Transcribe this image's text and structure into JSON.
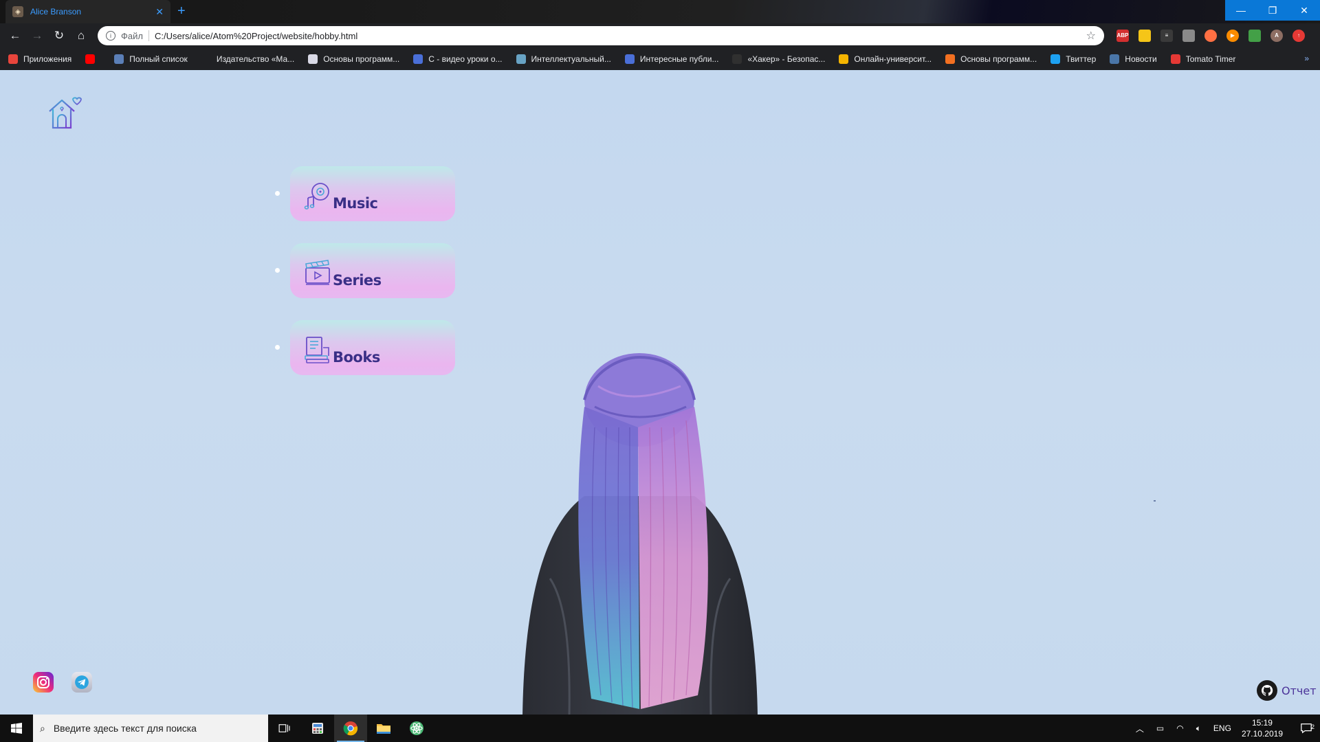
{
  "browser": {
    "tab_title": "Alice Branson",
    "tab_close": "✕",
    "new_tab": "+",
    "scheme_label": "Файл",
    "url": "C:/Users/alice/Atom%20Project/website/hobby.html",
    "window_controls": {
      "minimize": "—",
      "restore": "❐",
      "close": "✕"
    },
    "bookmarks": [
      {
        "label": "Приложения",
        "color": "#e8453c"
      },
      {
        "label": "",
        "color": "#ff0000"
      },
      {
        "label": "Полный список",
        "color": "#5b7fb7"
      },
      {
        "label": "Издательство «Ма...",
        "color": "#202124"
      },
      {
        "label": "Основы программ...",
        "color": "#d9d9e6"
      },
      {
        "label": "C - видео уроки о...",
        "color": "#4a6fd8"
      },
      {
        "label": "Интеллектуальный...",
        "color": "#68a3c4"
      },
      {
        "label": "Интересные публи...",
        "color": "#4a6fd8"
      },
      {
        "label": "«Хакер» - Безопас...",
        "color": "#303030"
      },
      {
        "label": "Онлайн-университ...",
        "color": "#f4b400"
      },
      {
        "label": "Основы программ...",
        "color": "#f37021"
      },
      {
        "label": "Твиттер",
        "color": "#1da1f2"
      },
      {
        "label": "Новости",
        "color": "#4a76a8"
      },
      {
        "label": "Tomato Timer",
        "color": "#e53935"
      }
    ],
    "bookmarks_more": "»"
  },
  "page": {
    "menu": [
      {
        "label": "Music",
        "icon": "music-disc-icon"
      },
      {
        "label": "Series",
        "icon": "clapperboard-icon"
      },
      {
        "label": "Books",
        "icon": "books-icon"
      }
    ],
    "report_label": "Отчет"
  },
  "taskbar": {
    "search_placeholder": "Введите здесь текст для поиска",
    "language": "ENG",
    "time": "15:19",
    "date": "27.10.2019",
    "notifications": "2"
  },
  "colors": {
    "page_background": "#c8daf0",
    "menu_text": "#3a2f86",
    "accent_blue": "#0a78d7"
  }
}
